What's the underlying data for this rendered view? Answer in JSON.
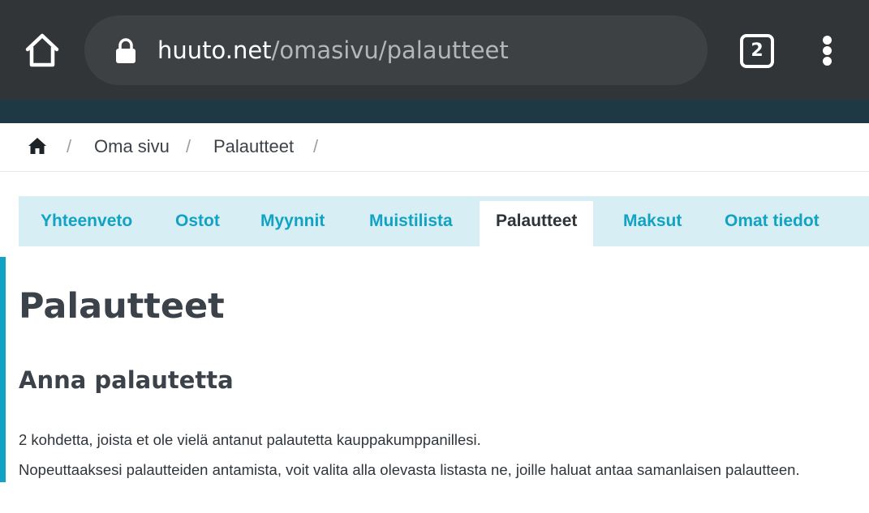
{
  "browser": {
    "url_host": "huuto.net",
    "url_path": "/omasivu/palautteet",
    "tab_count": "2"
  },
  "breadcrumb": {
    "items": [
      "Oma sivu",
      "Palautteet"
    ],
    "separator": "/"
  },
  "tabs": [
    {
      "label": "Yhteenveto",
      "active": false
    },
    {
      "label": "Ostot",
      "active": false
    },
    {
      "label": "Myynnit",
      "active": false
    },
    {
      "label": "Muistilista",
      "active": false
    },
    {
      "label": "Palautteet",
      "active": true
    },
    {
      "label": "Maksut",
      "active": false
    },
    {
      "label": "Omat tiedot",
      "active": false
    }
  ],
  "content": {
    "title": "Palautteet",
    "section_title": "Anna palautetta",
    "paragraphs": [
      "2 kohdetta, joista et ole vielä antanut palautetta kauppakumppanillesi.",
      "Nopeuttaaksesi palautteiden antamista, voit valita alla olevasta listasta ne, joille haluat antaa samanlaisen palautteen."
    ]
  },
  "colors": {
    "chrome": "#323537",
    "accent": "#11a3c3",
    "tab_bg": "#d8eef5",
    "site_header": "#1f3944"
  }
}
